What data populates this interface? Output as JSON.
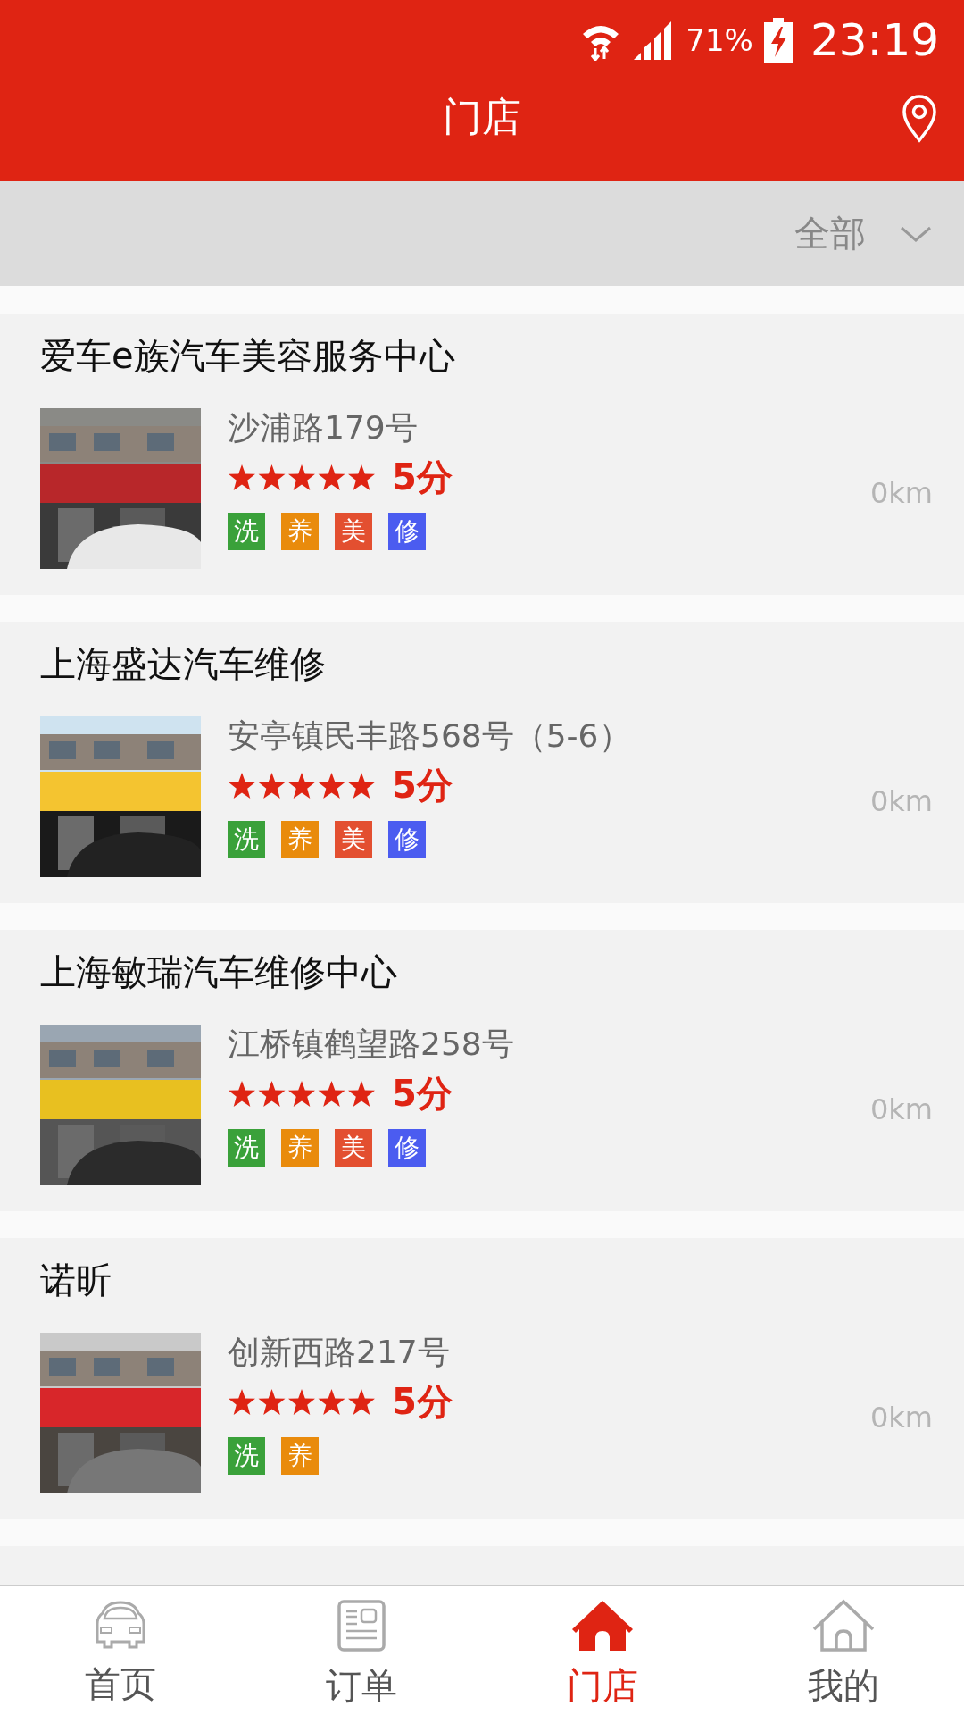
{
  "status_bar": {
    "battery": "71%",
    "time": "23:19"
  },
  "header": {
    "title": "门店"
  },
  "filter": {
    "label": "全部"
  },
  "stores": [
    {
      "name": "爱车e族汽车美容服务中心",
      "address": "沙浦路179号",
      "stars": 5,
      "score": "5分",
      "distance": "0km",
      "tags": [
        {
          "label": "洗",
          "color": "#3aa13a"
        },
        {
          "label": "养",
          "color": "#e98b0c"
        },
        {
          "label": "美",
          "color": "#e34f30"
        },
        {
          "label": "修",
          "color": "#4b5cf0"
        }
      ]
    },
    {
      "name": "上海盛达汽车维修",
      "address": "安亭镇民丰路568号（5-6）",
      "stars": 5,
      "score": "5分",
      "distance": "0km",
      "tags": [
        {
          "label": "洗",
          "color": "#3aa13a"
        },
        {
          "label": "养",
          "color": "#e98b0c"
        },
        {
          "label": "美",
          "color": "#e34f30"
        },
        {
          "label": "修",
          "color": "#4b5cf0"
        }
      ]
    },
    {
      "name": "上海敏瑞汽车维修中心",
      "address": "江桥镇鹤望路258号",
      "stars": 5,
      "score": "5分",
      "distance": "0km",
      "tags": [
        {
          "label": "洗",
          "color": "#3aa13a"
        },
        {
          "label": "养",
          "color": "#e98b0c"
        },
        {
          "label": "美",
          "color": "#e34f30"
        },
        {
          "label": "修",
          "color": "#4b5cf0"
        }
      ]
    },
    {
      "name": "诺昕",
      "address": "创新西路217号",
      "stars": 5,
      "score": "5分",
      "distance": "0km",
      "tags": [
        {
          "label": "洗",
          "color": "#3aa13a"
        },
        {
          "label": "养",
          "color": "#e98b0c"
        }
      ]
    }
  ],
  "nav": [
    {
      "label": "首页",
      "kind": "car",
      "selected": false
    },
    {
      "label": "订单",
      "kind": "order",
      "selected": false
    },
    {
      "label": "门店",
      "kind": "store",
      "selected": true
    },
    {
      "label": "我的",
      "kind": "home",
      "selected": false
    }
  ]
}
